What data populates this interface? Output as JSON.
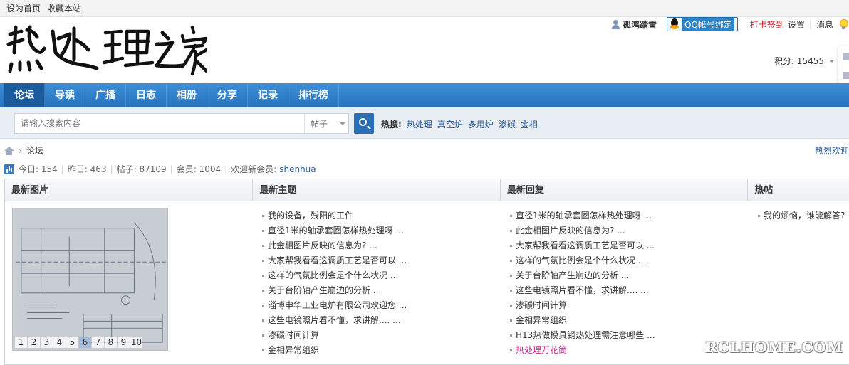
{
  "topbar": {
    "set_home": "设为首页",
    "bookmark": "收藏本站"
  },
  "logo": {
    "text": "热处理之家",
    "icon": "calligraphy-logo"
  },
  "user": {
    "name": "孤鸿踏雪",
    "qq_bind": "QQ帐号绑定",
    "checkin": "打卡签到",
    "settings": "设置",
    "messages": "消息",
    "credits": "积分: 15455"
  },
  "nav": [
    "论坛",
    "导读",
    "广播",
    "日志",
    "相册",
    "分享",
    "记录",
    "排行榜"
  ],
  "search": {
    "placeholder": "请输入搜索内容",
    "type": "帖子",
    "hot_label": "热搜:",
    "hot": [
      "热处理",
      "真空炉",
      "多用炉",
      "渗碳",
      "金相"
    ]
  },
  "breadcrumb": {
    "current": "论坛",
    "right_link": "热烈欢迎"
  },
  "stats": {
    "today": "今日: 154",
    "yesterday": "昨日: 463",
    "posts": "帖子: 87109",
    "members": "会员: 1004",
    "welcome": "欢迎新会员:",
    "new_member": "shenhua"
  },
  "columns": [
    "最新图片",
    "最新主题",
    "最新回复",
    "热帖"
  ],
  "pager": [
    "1",
    "2",
    "3",
    "4",
    "5",
    "6",
    "7",
    "8",
    "9",
    "10"
  ],
  "pager_active": 5,
  "latest_topics": [
    "我的设备，残阳的工件",
    "直径1米的轴承套圈怎样热处理呀 ...",
    "此金相图片反映的信息为? ...",
    "大家帮我看看这调质工艺是否可以 ...",
    "这样的气氛比例会是个什么状况 ...",
    "关于台阶轴产生崩边的分析 ...",
    "淄博申华工业电炉有限公司欢迎您 ...",
    "这些电镜照片看不懂，求讲解.... ...",
    "渗碳时间计算",
    "金相异常组织"
  ],
  "latest_replies": [
    "直径1米的轴承套圈怎样热处理呀 ...",
    "此金相图片反映的信息为? ...",
    "大家帮我看看这调质工艺是否可以 ...",
    "这样的气氛比例会是个什么状况 ...",
    "关于台阶轴产生崩边的分析 ...",
    "这些电镜照片看不懂，求讲解.... ...",
    "渗碳时间计算",
    "金相异常组织",
    "H13热做模具钢热处理需注意哪些 ...",
    "热处理万花筒"
  ],
  "hot_posts": [
    "我的烦恼，谁能解答?"
  ],
  "watermark": "RCLHOME.COM",
  "colors": {
    "nav": "#2a73be",
    "link": "#2a5b9c",
    "checkin": "#d0161b",
    "pink": "#c0228a"
  }
}
